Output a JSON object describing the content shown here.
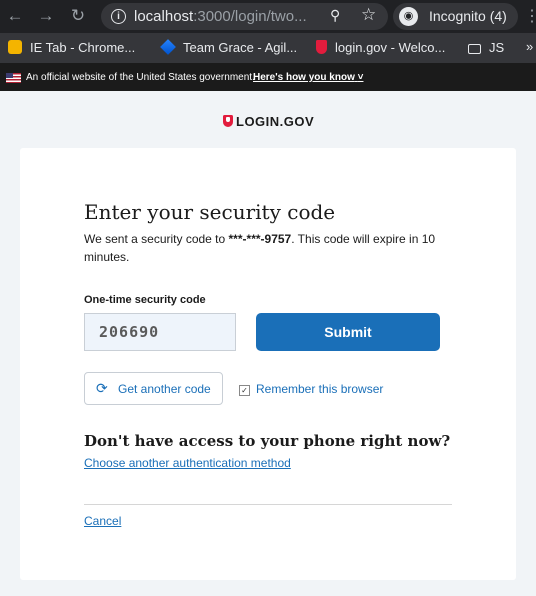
{
  "browser": {
    "url_host": "localhost",
    "url_path": ":3000/login/two...",
    "incognito_label": "Incognito (4)",
    "bookmarks": [
      {
        "label": "IE Tab - Chrome...",
        "icon": "ie-tab-icon"
      },
      {
        "label": "Team Grace - Agil...",
        "icon": "jira-icon"
      },
      {
        "label": "login.gov - Welco...",
        "icon": "login-gov-shield-icon"
      },
      {
        "label": "JS",
        "icon": "folder-icon"
      }
    ],
    "more_label": "»"
  },
  "gov_banner": {
    "text": "An official website of the United States government.",
    "link": "Here's how you know"
  },
  "logo": {
    "text": "LOGIN.GOV"
  },
  "form": {
    "title": "Enter your security code",
    "desc_prefix": "We sent a security code to ",
    "phone": "***-***-9757",
    "desc_suffix": ". This code will expire in 10 minutes.",
    "code_label": "One-time security code",
    "code_value": "206690",
    "submit_label": "Submit",
    "resend_label": "Get another code",
    "remember_label": "Remember this browser",
    "remember_checked": true,
    "no_access_heading": "Don't have access to your phone right now?",
    "alt_method_link": "Choose another authentication method",
    "cancel_link": "Cancel"
  },
  "colors": {
    "primary": "#1a6fb8",
    "page_bg": "#f1f4f7",
    "brand_red": "#e21c3d"
  }
}
